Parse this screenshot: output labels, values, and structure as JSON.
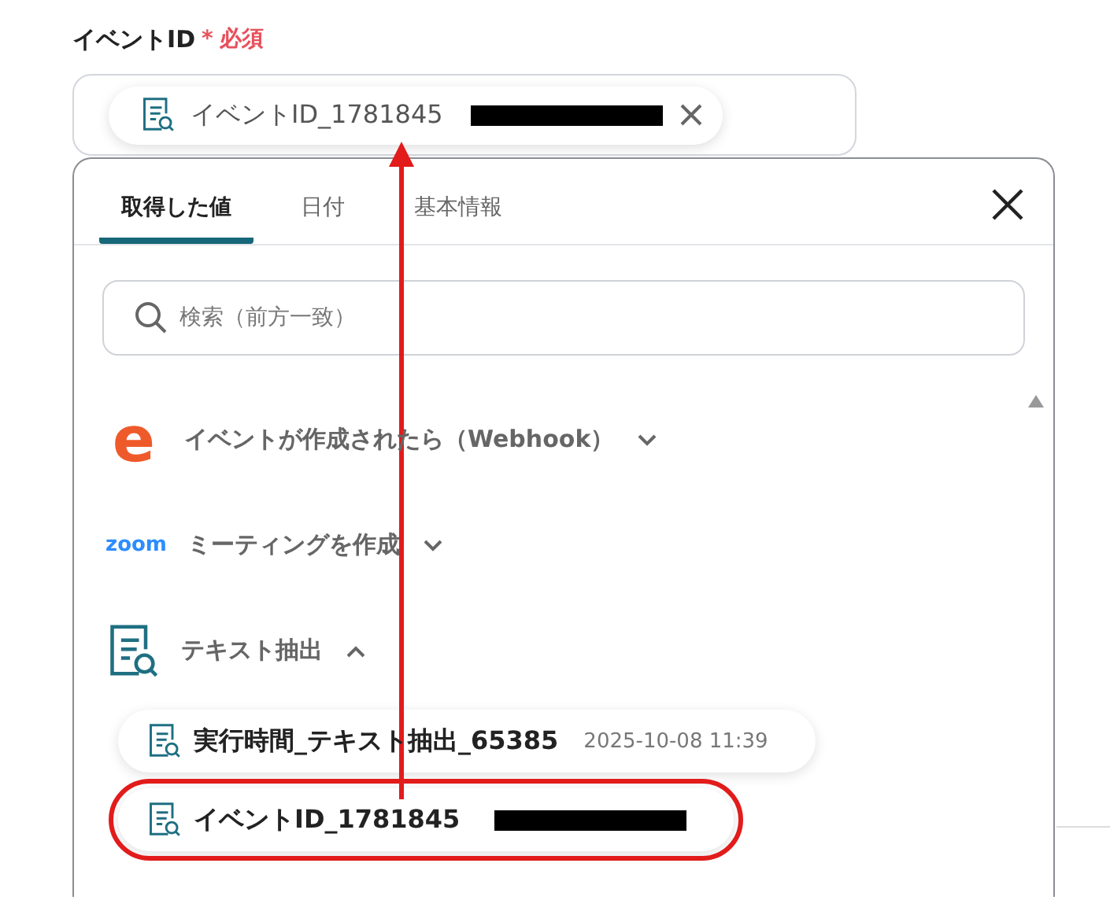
{
  "field": {
    "label": "イベントID",
    "required_mark": "*",
    "required_text": "必須",
    "chip": {
      "text": "イベントID_1781845",
      "redacted": true
    }
  },
  "popup": {
    "tabs": [
      {
        "label": "取得した値",
        "selected": true
      },
      {
        "label": "日付",
        "selected": false
      },
      {
        "label": "基本情報",
        "selected": false
      }
    ],
    "search": {
      "placeholder": "検索（前方一致）"
    },
    "groups": [
      {
        "kind": "brand",
        "logo_text": "e",
        "title": "イベントが作成されたら（Webhook）",
        "expanded": false
      },
      {
        "kind": "wordmark",
        "logo_text": "zoom",
        "title": "ミーティングを作成",
        "expanded": false
      },
      {
        "kind": "document",
        "title": "テキスト抽出",
        "expanded": true
      }
    ],
    "items": [
      {
        "name": "実行時間_テキスト抽出_65385",
        "value": "2025-10-08 11:39",
        "redacted": false,
        "highlighted": false
      },
      {
        "name": "イベントID_1781845",
        "redacted": true,
        "highlighted": true
      }
    ]
  }
}
